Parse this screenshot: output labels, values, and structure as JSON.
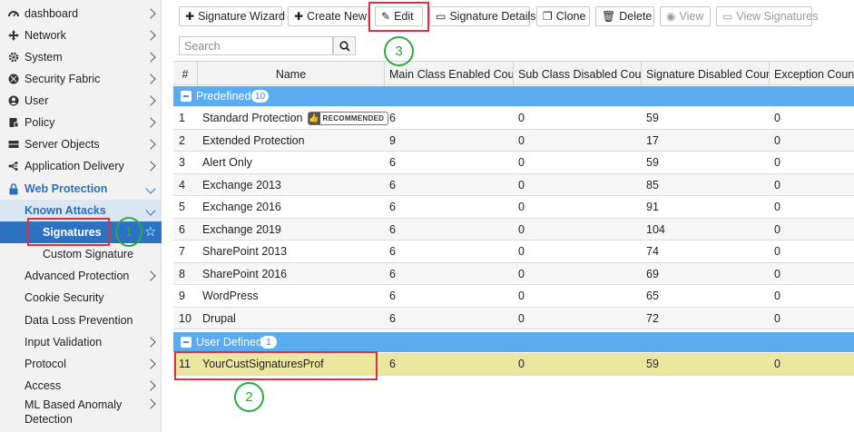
{
  "sidebar": {
    "items": [
      {
        "label": "dashboard",
        "icon": "dashboard-icon"
      },
      {
        "label": "Network",
        "icon": "network-icon"
      },
      {
        "label": "System",
        "icon": "gear-icon"
      },
      {
        "label": "Security Fabric",
        "icon": "security-fabric-icon"
      },
      {
        "label": "User",
        "icon": "user-icon"
      },
      {
        "label": "Policy",
        "icon": "policy-icon"
      },
      {
        "label": "Server Objects",
        "icon": "server-icon"
      },
      {
        "label": "Application Delivery",
        "icon": "app-delivery-icon"
      },
      {
        "label": "Web Protection",
        "icon": "lock-icon"
      }
    ],
    "sub": {
      "label": "Known Attacks"
    },
    "selected": {
      "label": "Signatures"
    },
    "custom": {
      "label": "Custom Signature"
    },
    "more": [
      {
        "label": "Advanced Protection"
      },
      {
        "label": "Cookie Security"
      },
      {
        "label": "Data Loss Prevention"
      },
      {
        "label": "Input Validation"
      },
      {
        "label": "Protocol"
      },
      {
        "label": "Access"
      },
      {
        "label": "ML Based Anomaly"
      },
      {
        "label": "Detection"
      }
    ]
  },
  "toolbar": {
    "wizard": "Signature Wizard",
    "create": "Create New",
    "edit": "Edit",
    "details": "Signature Details",
    "clone": "Clone",
    "delete": "Delete",
    "view": "View",
    "view_sigs": "View Signatures"
  },
  "search": {
    "placeholder": "Search"
  },
  "table": {
    "headers": [
      "#",
      "Name",
      "Main Class Enabled Count",
      "Sub Class Disabled Count",
      "Signature Disabled Count",
      "Exception Count"
    ],
    "groups": [
      {
        "name": "Predefined",
        "count": "10"
      },
      {
        "name": "User Defined",
        "count": "1"
      }
    ],
    "badge": "RECOMMENDED",
    "rows": [
      {
        "num": "1",
        "name": "Standard Protection",
        "main": "6",
        "sub": "0",
        "sig": "59",
        "exc": "0"
      },
      {
        "num": "2",
        "name": "Extended Protection",
        "main": "9",
        "sub": "0",
        "sig": "17",
        "exc": "0"
      },
      {
        "num": "3",
        "name": "Alert Only",
        "main": "6",
        "sub": "0",
        "sig": "59",
        "exc": "0"
      },
      {
        "num": "4",
        "name": "Exchange 2013",
        "main": "6",
        "sub": "0",
        "sig": "85",
        "exc": "0"
      },
      {
        "num": "5",
        "name": "Exchange 2016",
        "main": "6",
        "sub": "0",
        "sig": "91",
        "exc": "0"
      },
      {
        "num": "6",
        "name": "Exchange 2019",
        "main": "6",
        "sub": "0",
        "sig": "104",
        "exc": "0"
      },
      {
        "num": "7",
        "name": "SharePoint 2013",
        "main": "6",
        "sub": "0",
        "sig": "74",
        "exc": "0"
      },
      {
        "num": "8",
        "name": "SharePoint 2016",
        "main": "6",
        "sub": "0",
        "sig": "69",
        "exc": "0"
      },
      {
        "num": "9",
        "name": "WordPress",
        "main": "6",
        "sub": "0",
        "sig": "65",
        "exc": "0"
      },
      {
        "num": "10",
        "name": "Drupal",
        "main": "6",
        "sub": "0",
        "sig": "72",
        "exc": "0"
      }
    ],
    "user_rows": [
      {
        "num": "11",
        "name": "YourCustSignaturesProf",
        "main": "6",
        "sub": "0",
        "sig": "59",
        "exc": "0"
      }
    ]
  },
  "annotations": {
    "one": "1",
    "two": "2",
    "three": "3"
  },
  "colors": {
    "accent": "#2c72c0",
    "group": "#5aabf0",
    "highlight": "#ece79e",
    "callout_red": "#d9333f",
    "callout_green": "#2aa84a"
  }
}
